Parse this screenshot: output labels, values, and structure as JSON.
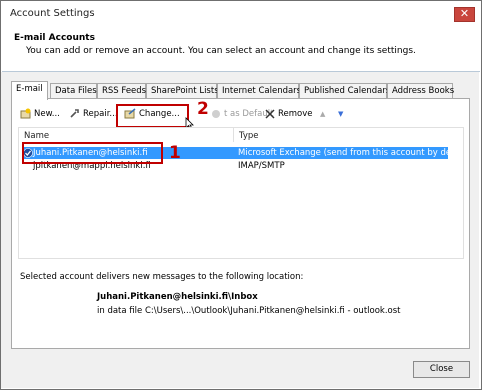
{
  "window": {
    "title": "Account Settings",
    "close_glyph": "✕"
  },
  "header": {
    "title": "E-mail Accounts",
    "subtitle": "You can add or remove an account. You can select an account and change its settings."
  },
  "tabs": [
    {
      "label": "E-mail",
      "active": true
    },
    {
      "label": "Data Files"
    },
    {
      "label": "RSS Feeds"
    },
    {
      "label": "SharePoint Lists"
    },
    {
      "label": "Internet Calendars"
    },
    {
      "label": "Published Calendars"
    },
    {
      "label": "Address Books"
    }
  ],
  "toolbar": {
    "new_label": "New...",
    "repair_label": "Repair...",
    "change_label": "Change...",
    "set_default_label": "t as Default",
    "remove_label": "Remove",
    "up_glyph": "▲",
    "down_glyph": "▼"
  },
  "accounts": {
    "columns": {
      "name": "Name",
      "type": "Type"
    },
    "rows": [
      {
        "name": "Juhani.Pitkanen@helsinki.fi",
        "type": "Microsoft Exchange (send from this account by def...",
        "selected": true,
        "default": true
      },
      {
        "name": "jpitkanen@mappi.helsinki.fi",
        "type": "IMAP/SMTP",
        "selected": false
      }
    ]
  },
  "annotations": {
    "step1": "1",
    "step2": "2",
    "color": "#c00000"
  },
  "location": {
    "label": "Selected account delivers new messages to the following location:",
    "inbox": "Juhani.Pitkanen@helsinki.fi\\Inbox",
    "file": "in data file C:\\Users\\...\\Outlook\\Juhani.Pitkanen@helsinki.fi - outlook.ost"
  },
  "footer": {
    "close_label": "Close"
  },
  "colors": {
    "selection": "#3399ff",
    "accent": "#c00000"
  }
}
